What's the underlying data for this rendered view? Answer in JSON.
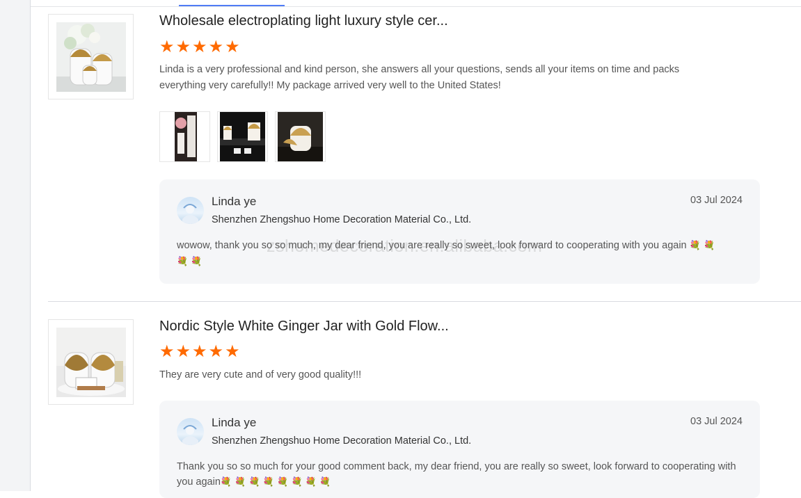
{
  "reviews": [
    {
      "product_title": "Wholesale electroplating light luxury style cer...",
      "rating": 5,
      "text": "Linda is a very professional and kind person, she answers all your questions, sends all your items on time and packs everything very carefully!!  My package arrived very well to the United States!",
      "photo_count": 3,
      "reply": {
        "name": "Linda ye",
        "company": "Shenzhen Zhengshuo Home Decoration Material Co., Ltd.",
        "date": "03 Jul 2024",
        "text": "wowow, thank you so so much, my dear friend, you are really so sweet, look forward to cooperating with you again",
        "emoji_count": 4,
        "emoji_icon": "bouquet-icon"
      }
    },
    {
      "product_title": "Nordic Style White Ginger Jar with Gold Flow...",
      "rating": 5,
      "text": "They are very cute and of very good quality!!!",
      "reply": {
        "name": "Linda ye",
        "company": "Shenzhen Zhengshuo Home Decoration Material Co., Ltd.",
        "date": "03 Jul 2024",
        "text": "Thank you so so much for your good comment back, my dear friend, you are really so sweet, look forward to cooperating with you again",
        "emoji_count": 8,
        "emoji_icon": "bouquet-icon"
      }
    }
  ],
  "watermark": "zshomedecoration.en.alibaba.com",
  "colors": {
    "star": "#ff6a00",
    "reply_bg": "#f5f6f8",
    "active_tab": "#4f7cf5"
  }
}
